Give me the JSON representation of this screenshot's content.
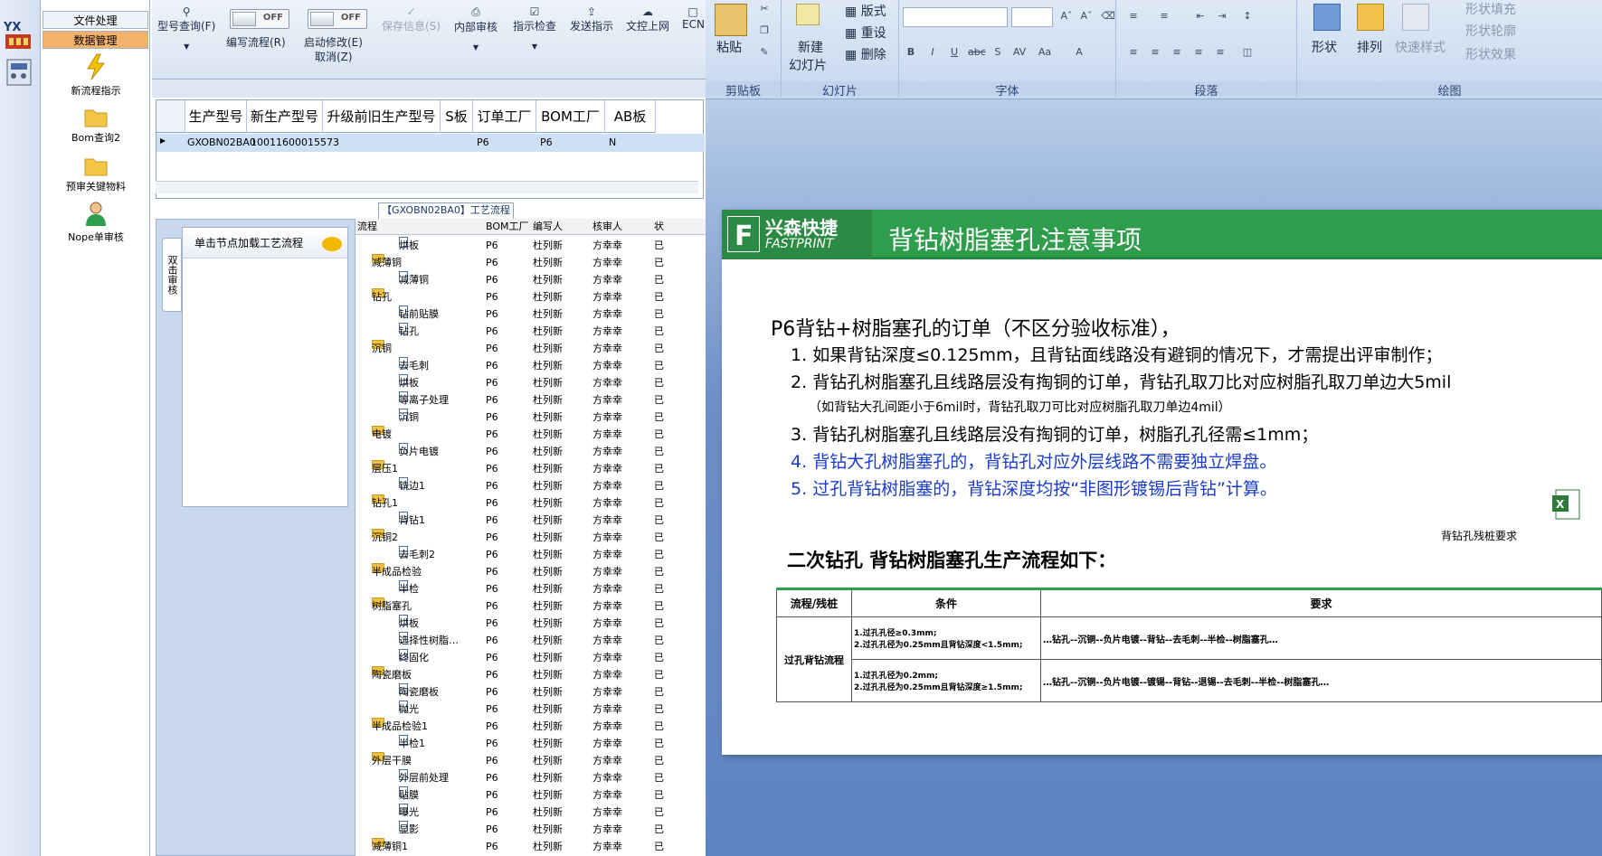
{
  "left_strip": {
    "logo_text": "YX"
  },
  "nav": {
    "tab_file": "文件处理",
    "tab_data": "数据管理",
    "items": [
      {
        "label": "新流程指示",
        "icon": "lightning-icon"
      },
      {
        "label": "Bom查询2",
        "icon": "folder-icon"
      },
      {
        "label": "预审关键物料",
        "icon": "folder-icon"
      },
      {
        "label": "Nope单审核",
        "icon": "user-icon"
      }
    ]
  },
  "toolbar": {
    "query": "型号查询(F)",
    "edit_flow": "编写流程(R)",
    "edit_flow_toggle": "OFF",
    "start_edit": "启动修改(E)",
    "start_edit_toggle": "OFF",
    "cancel": "取消(Z)",
    "save": "保存信息(S)",
    "internal_review": "内部审核",
    "check": "指示检查",
    "send": "发送指示",
    "upload": "文控上网",
    "ecn": "ECN"
  },
  "grid": {
    "headers": [
      "生产型号",
      "新生产型号",
      "升级前旧生产型号",
      "S板",
      "订单工厂",
      "BOM工厂",
      "AB板"
    ],
    "row": {
      "prod_model": "GXOBN02BA0",
      "new_model": "10011600015573",
      "order_factory": "P6",
      "bom_factory": "P6",
      "ab": "N"
    }
  },
  "process": {
    "title": "【GXOBN02BA0】工艺流程",
    "vtab": "双击审核",
    "node_header": "单击节点加载工艺流程",
    "columns": [
      "流程",
      "BOM工厂",
      "编写人",
      "核审人",
      "状"
    ],
    "rows": [
      {
        "name": "烘板",
        "level": 2,
        "folder": false,
        "bom": "P6",
        "writer": "杜列新",
        "reviewer": "方幸幸",
        "status": "已"
      },
      {
        "name": "减薄铜",
        "level": 1,
        "folder": true,
        "bom": "P6",
        "writer": "杜列新",
        "reviewer": "方幸幸",
        "status": "已"
      },
      {
        "name": "减薄铜",
        "level": 2,
        "folder": false,
        "bom": "P6",
        "writer": "杜列新",
        "reviewer": "方幸幸",
        "status": "已"
      },
      {
        "name": "钻孔",
        "level": 1,
        "folder": true,
        "bom": "P6",
        "writer": "杜列新",
        "reviewer": "方幸幸",
        "status": "已"
      },
      {
        "name": "钻前贴膜",
        "level": 2,
        "folder": false,
        "bom": "P6",
        "writer": "杜列新",
        "reviewer": "方幸幸",
        "status": "已"
      },
      {
        "name": "钻孔",
        "level": 2,
        "folder": false,
        "bom": "P6",
        "writer": "杜列新",
        "reviewer": "方幸幸",
        "status": "已"
      },
      {
        "name": "沉铜",
        "level": 1,
        "folder": true,
        "bom": "P6",
        "writer": "杜列新",
        "reviewer": "方幸幸",
        "status": "已"
      },
      {
        "name": "去毛刺",
        "level": 2,
        "folder": false,
        "bom": "P6",
        "writer": "杜列新",
        "reviewer": "方幸幸",
        "status": "已"
      },
      {
        "name": "烘板",
        "level": 2,
        "folder": false,
        "bom": "P6",
        "writer": "杜列新",
        "reviewer": "方幸幸",
        "status": "已"
      },
      {
        "name": "等离子处理",
        "level": 2,
        "folder": false,
        "bom": "P6",
        "writer": "杜列新",
        "reviewer": "方幸幸",
        "status": "已"
      },
      {
        "name": "沉铜",
        "level": 2,
        "folder": false,
        "bom": "P6",
        "writer": "杜列新",
        "reviewer": "方幸幸",
        "status": "已"
      },
      {
        "name": "电镀",
        "level": 1,
        "folder": true,
        "bom": "P6",
        "writer": "杜列新",
        "reviewer": "方幸幸",
        "status": "已"
      },
      {
        "name": "负片电镀",
        "level": 2,
        "folder": false,
        "bom": "P6",
        "writer": "杜列新",
        "reviewer": "方幸幸",
        "status": "已"
      },
      {
        "name": "层压1",
        "level": 1,
        "folder": true,
        "bom": "P6",
        "writer": "杜列新",
        "reviewer": "方幸幸",
        "status": "已"
      },
      {
        "name": "铣边1",
        "level": 2,
        "folder": false,
        "bom": "P6",
        "writer": "杜列新",
        "reviewer": "方幸幸",
        "status": "已"
      },
      {
        "name": "钻孔1",
        "level": 1,
        "folder": true,
        "bom": "P6",
        "writer": "杜列新",
        "reviewer": "方幸幸",
        "status": "已"
      },
      {
        "name": "背钻1",
        "level": 2,
        "folder": false,
        "bom": "P6",
        "writer": "杜列新",
        "reviewer": "方幸幸",
        "status": "已"
      },
      {
        "name": "沉铜2",
        "level": 1,
        "folder": true,
        "bom": "P6",
        "writer": "杜列新",
        "reviewer": "方幸幸",
        "status": "已"
      },
      {
        "name": "去毛刺2",
        "level": 2,
        "folder": false,
        "bom": "P6",
        "writer": "杜列新",
        "reviewer": "方幸幸",
        "status": "已"
      },
      {
        "name": "半成品检验",
        "level": 1,
        "folder": true,
        "bom": "P6",
        "writer": "杜列新",
        "reviewer": "方幸幸",
        "status": "已"
      },
      {
        "name": "半检",
        "level": 2,
        "folder": false,
        "bom": "P6",
        "writer": "杜列新",
        "reviewer": "方幸幸",
        "status": "已"
      },
      {
        "name": "树脂塞孔",
        "level": 1,
        "folder": true,
        "bom": "P6",
        "writer": "杜列新",
        "reviewer": "方幸幸",
        "status": "已"
      },
      {
        "name": "烘板",
        "level": 2,
        "folder": false,
        "bom": "P6",
        "writer": "杜列新",
        "reviewer": "方幸幸",
        "status": "已"
      },
      {
        "name": "选择性树脂…",
        "level": 2,
        "folder": false,
        "bom": "P6",
        "writer": "杜列新",
        "reviewer": "方幸幸",
        "status": "已"
      },
      {
        "name": "终固化",
        "level": 2,
        "folder": false,
        "bom": "P6",
        "writer": "杜列新",
        "reviewer": "方幸幸",
        "status": "已"
      },
      {
        "name": "陶瓷磨板",
        "level": 1,
        "folder": true,
        "bom": "P6",
        "writer": "杜列新",
        "reviewer": "方幸幸",
        "status": "已"
      },
      {
        "name": "陶瓷磨板",
        "level": 2,
        "folder": false,
        "bom": "P6",
        "writer": "杜列新",
        "reviewer": "方幸幸",
        "status": "已"
      },
      {
        "name": "抛光",
        "level": 2,
        "folder": false,
        "bom": "P6",
        "writer": "杜列新",
        "reviewer": "方幸幸",
        "status": "已"
      },
      {
        "name": "半成品检验1",
        "level": 1,
        "folder": true,
        "bom": "P6",
        "writer": "杜列新",
        "reviewer": "方幸幸",
        "status": "已"
      },
      {
        "name": "半检1",
        "level": 2,
        "folder": false,
        "bom": "P6",
        "writer": "杜列新",
        "reviewer": "方幸幸",
        "status": "已"
      },
      {
        "name": "外层干膜",
        "level": 1,
        "folder": true,
        "bom": "P6",
        "writer": "杜列新",
        "reviewer": "方幸幸",
        "status": "已"
      },
      {
        "name": "外层前处理",
        "level": 2,
        "folder": false,
        "bom": "P6",
        "writer": "杜列新",
        "reviewer": "方幸幸",
        "status": "已"
      },
      {
        "name": "贴膜",
        "level": 2,
        "folder": false,
        "bom": "P6",
        "writer": "杜列新",
        "reviewer": "方幸幸",
        "status": "已"
      },
      {
        "name": "曝光",
        "level": 2,
        "folder": false,
        "bom": "P6",
        "writer": "杜列新",
        "reviewer": "方幸幸",
        "status": "已"
      },
      {
        "name": "显影",
        "level": 2,
        "folder": false,
        "bom": "P6",
        "writer": "杜列新",
        "reviewer": "方幸幸",
        "status": "已"
      },
      {
        "name": "减薄铜1",
        "level": 1,
        "folder": true,
        "bom": "P6",
        "writer": "杜列新",
        "reviewer": "方幸幸",
        "status": "已"
      }
    ]
  },
  "ribbon": {
    "clipboard": {
      "paste": "粘贴",
      "group": "剪贴板"
    },
    "slides": {
      "new_slide": "新建",
      "new_slide2": "幻灯片",
      "layout": "版式",
      "reset": "重设",
      "delete": "删除",
      "group": "幻灯片"
    },
    "font": {
      "group": "字体"
    },
    "paragraph": {
      "group": "段落"
    },
    "drawing": {
      "shape": "形状",
      "arrange": "排列",
      "quick_style": "快速样式",
      "fill": "形状填充",
      "outline": "形状轮廓",
      "effect": "形状效果",
      "group": "绘图"
    }
  },
  "slide": {
    "logo_cn": "兴森快捷",
    "logo_en": "FASTPRINT",
    "title": "背钻树脂塞孔注意事项",
    "intro": "P6背钻+树脂塞孔的订单（不区分验收标准），",
    "items": [
      {
        "num": "1.",
        "text": "如果背钻深度≤0.125mm，且背钻面线路没有避铜的情况下，才需提出评审制作；"
      },
      {
        "num": "2.",
        "text": "背钻孔树脂塞孔且线路层没有掏铜的订单，背钻孔取刀比对应树脂孔取刀单边大5mil"
      },
      {
        "num": "",
        "text": "（如背钻大孔间距小于6mil时，背钻孔取刀可比对应树脂孔取刀单边4mil）"
      },
      {
        "num": "3.",
        "text": "背钻孔树脂塞孔且线路层没有掏铜的订单，树脂孔孔径需≤1mm；"
      },
      {
        "num": "4.",
        "text": "背钻大孔树脂塞孔的，背钻孔对应外层线路不需要独立焊盘。"
      },
      {
        "num": "5.",
        "text": "过孔背钻树脂塞的，背钻深度均按“非图形镀锡后背钻”计算。"
      }
    ],
    "attachment": "背钻孔残桩要求",
    "section_title": "二次钻孔 背钻树脂塞孔生产流程如下：",
    "table": {
      "headers": [
        "流程/残桩",
        "条件",
        "要求"
      ],
      "row_label": "过孔背钻流程",
      "rows": [
        {
          "cond1": "1.过孔孔径≥0.3mm;",
          "cond2": "2.过孔孔径为0.25mm且背钻深度<1.5mm;",
          "req": "…钻孔--沉铜--负片电镀--背钻--去毛刺--半检--树脂塞孔…"
        },
        {
          "cond1": "1.过孔孔径为0.2mm;",
          "cond2": "2.过孔孔径为0.25mm且背钻深度≥1.5mm;",
          "req": "…钻孔--沉铜--负片电镀--镀锡--背钻--退锡--去毛刺--半检--树脂塞孔…"
        }
      ]
    }
  },
  "colors": {
    "accent_green": "#2f9e4c",
    "blue_text": "#1a3cc8",
    "nav_orange": "#f5b26a"
  }
}
